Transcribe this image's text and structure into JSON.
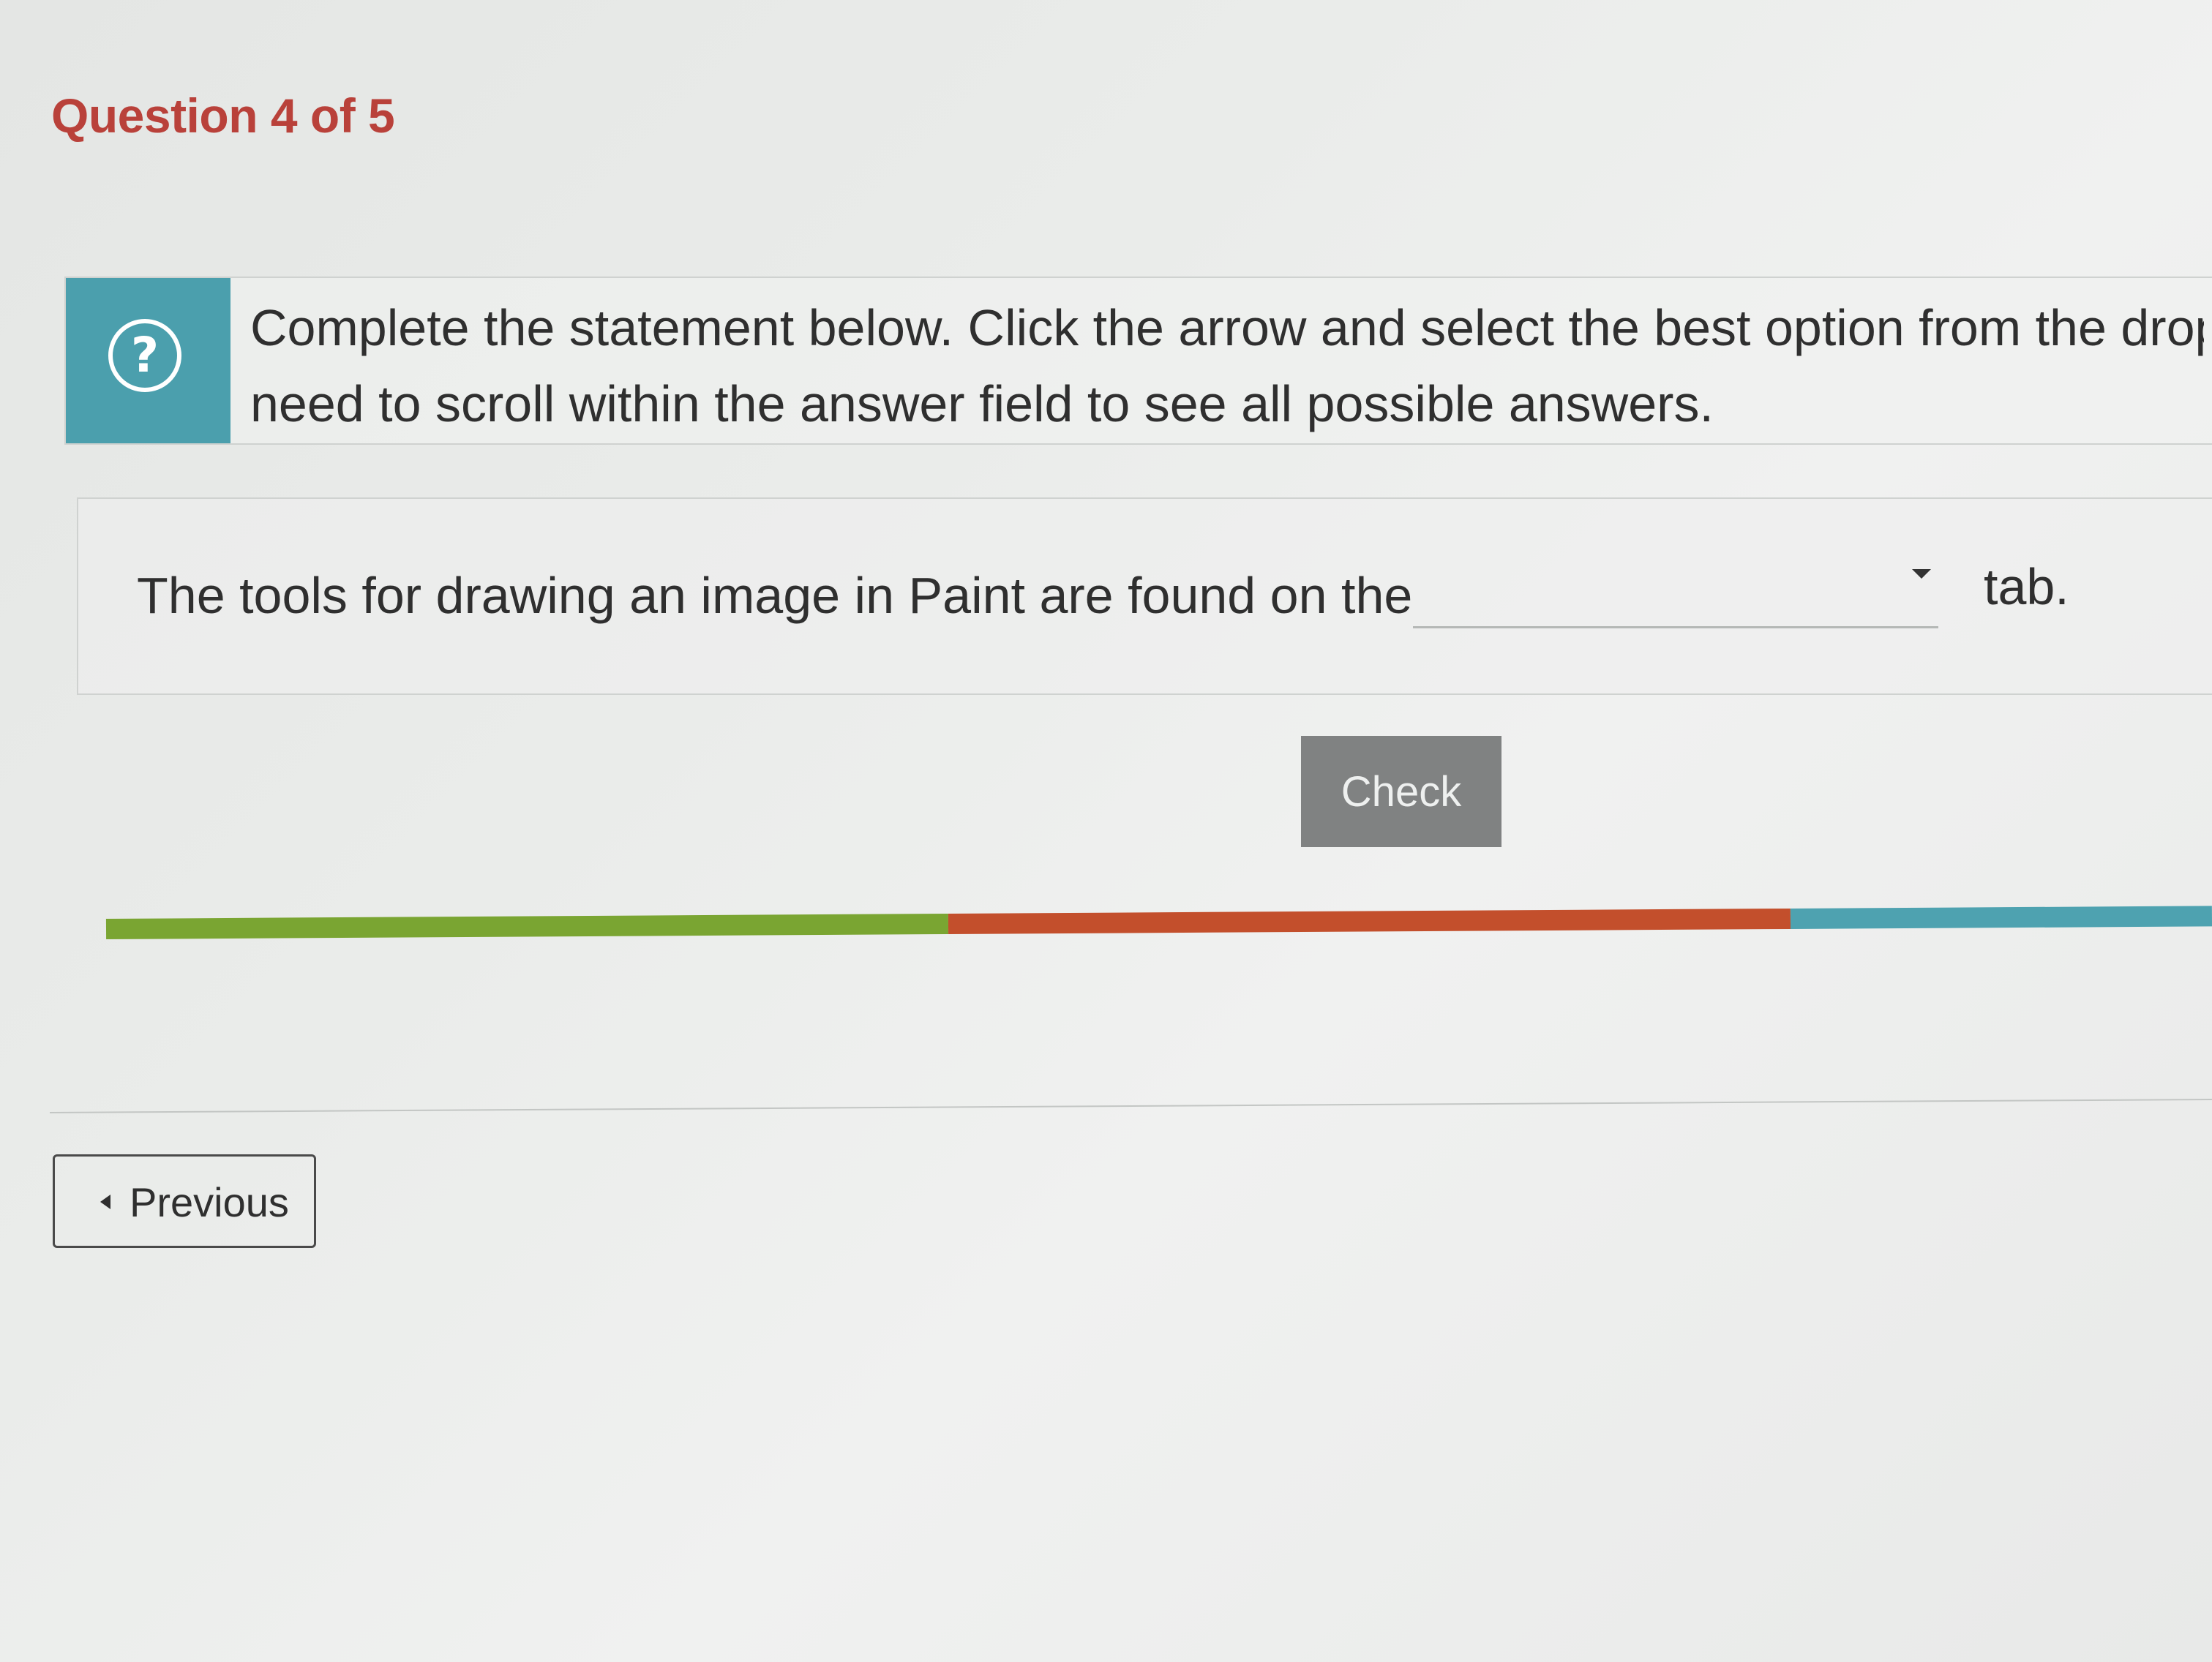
{
  "header": {
    "question_counter": "Question 4 of 5"
  },
  "instruction": {
    "icon": "help-circle-icon",
    "line1": "Complete the statement below.  Click the arrow and select the best option from the drop-",
    "line2": "need to scroll within the answer field to see all possible answers."
  },
  "statement": {
    "prefix": "The tools for drawing an image in Paint are found on the",
    "dropdown_value": "",
    "suffix": "tab."
  },
  "actions": {
    "check_label": "Check",
    "previous_label": "Previous"
  },
  "progress": {
    "segments": [
      {
        "status": "correct",
        "fraction": 0.4,
        "color": "#7aa532"
      },
      {
        "status": "incorrect",
        "fraction": 0.4,
        "color": "#c34f2c"
      },
      {
        "status": "remaining",
        "fraction": 0.2,
        "color": "#4ea2b0"
      }
    ]
  },
  "colors": {
    "accent_red": "#b9413a",
    "icon_teal": "#4b9fad",
    "button_gray": "#808282"
  }
}
